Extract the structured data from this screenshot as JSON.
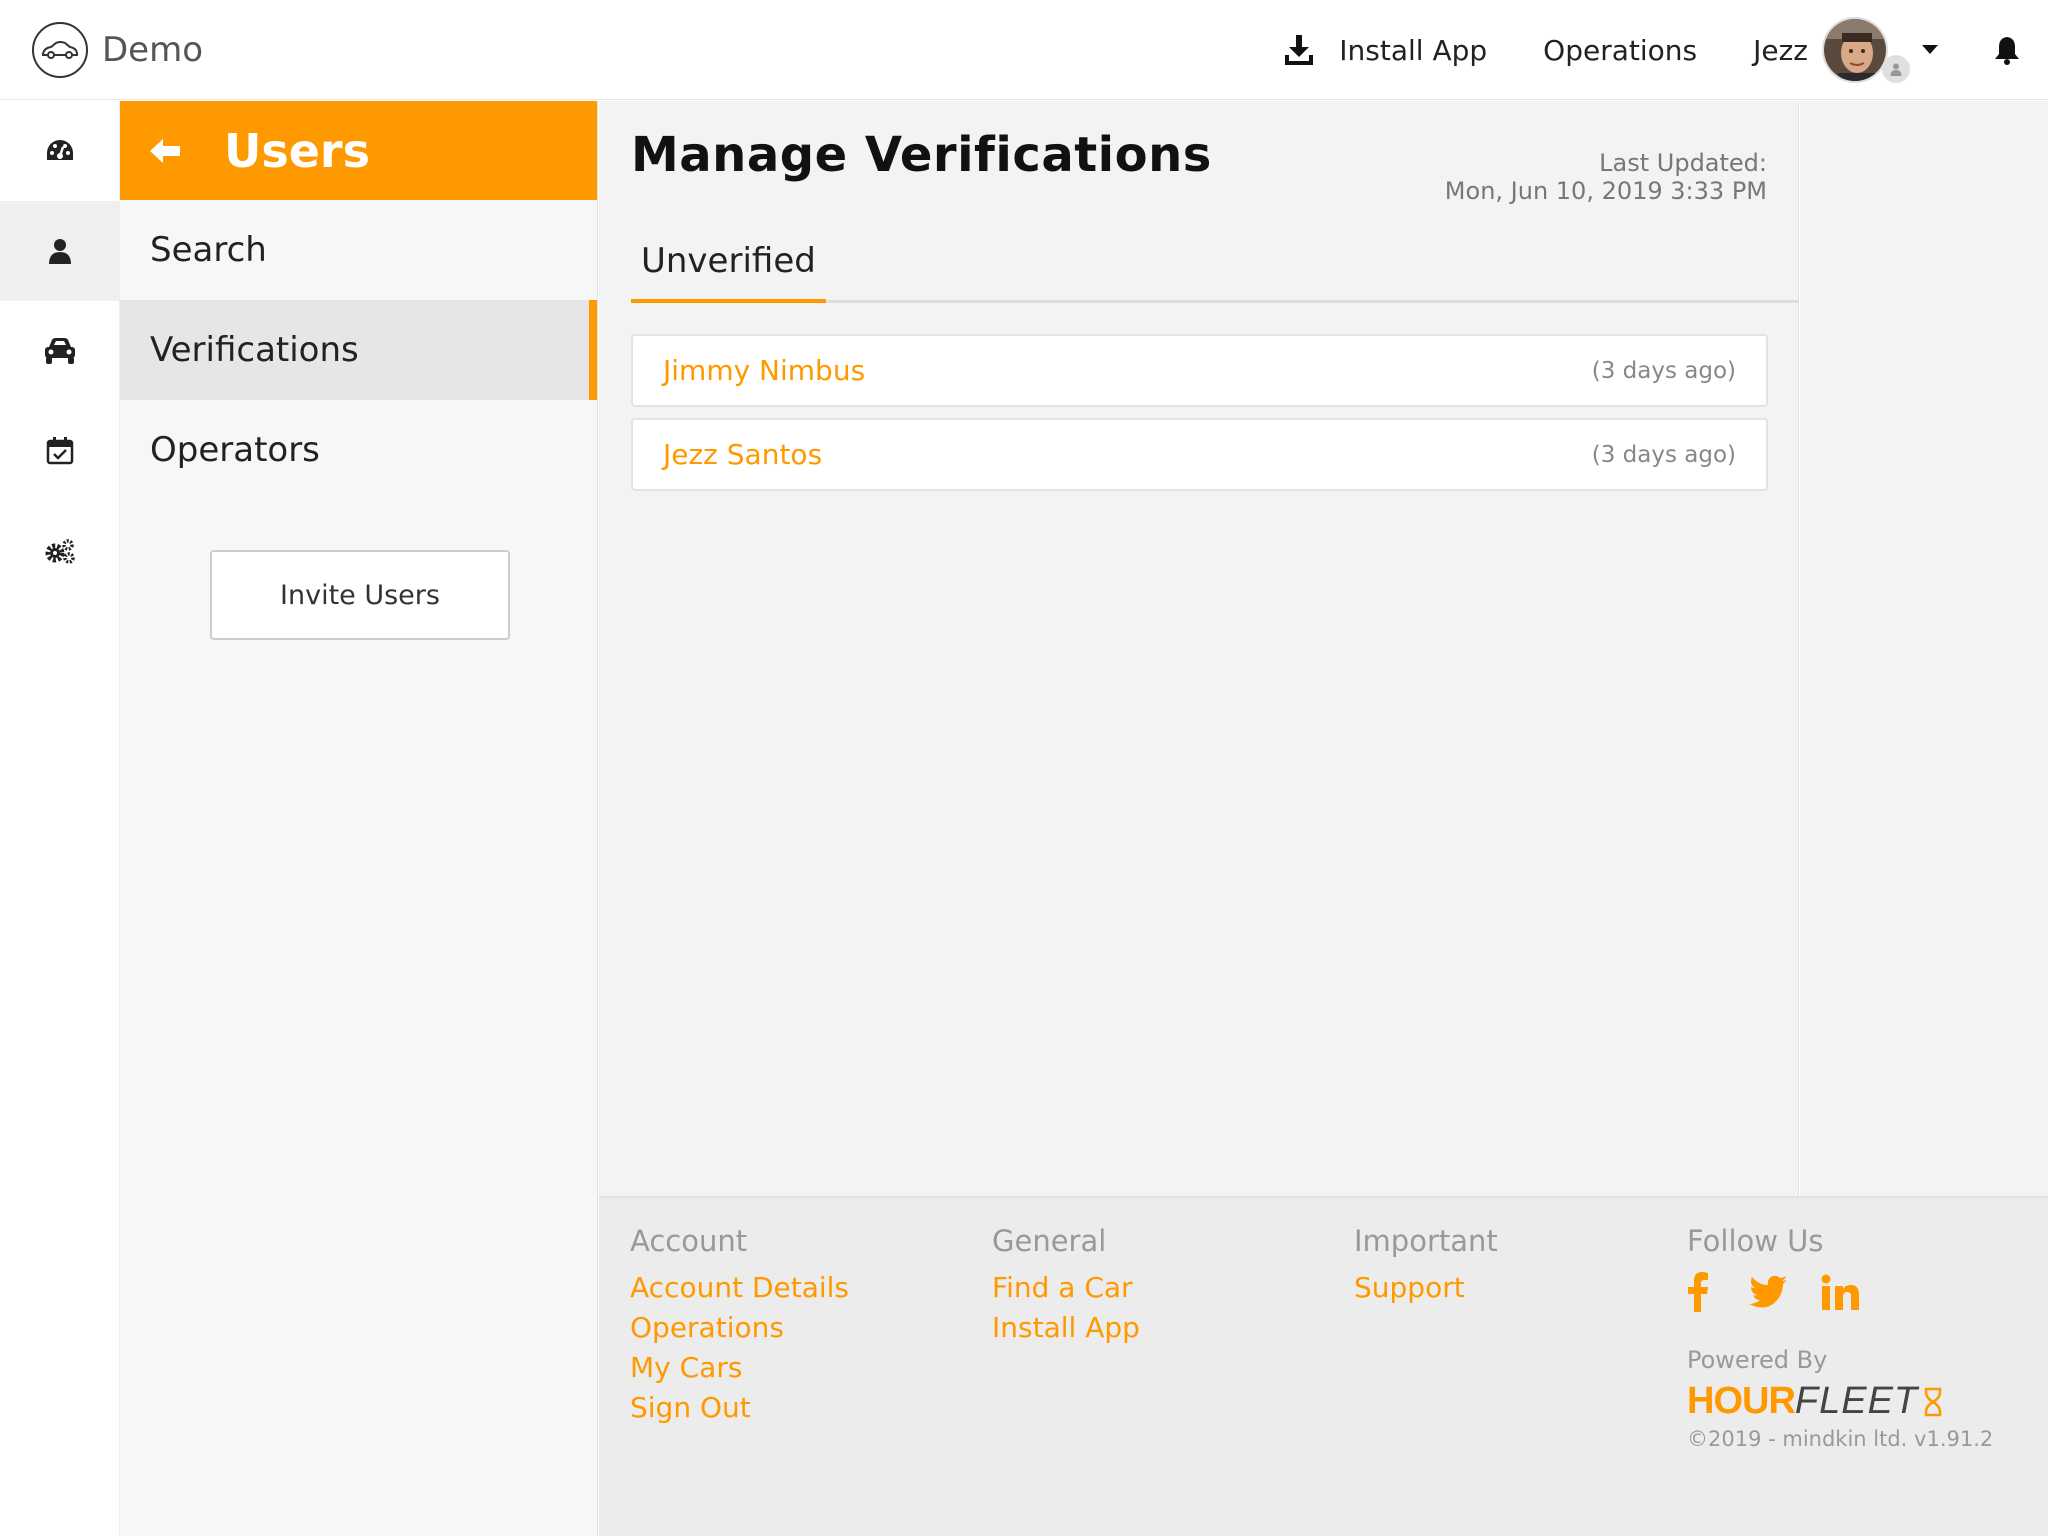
{
  "brand": {
    "name": "Demo",
    "logo_icon": "car-logo-icon"
  },
  "top_nav": {
    "install_label": "Install App",
    "operations_label": "Operations",
    "user_name": "Jezz"
  },
  "rail": {
    "items": [
      {
        "icon": "dashboard-icon",
        "active": false
      },
      {
        "icon": "user-icon",
        "active": true
      },
      {
        "icon": "car-icon",
        "active": false
      },
      {
        "icon": "calendar-check-icon",
        "active": false
      },
      {
        "icon": "gears-icon",
        "active": false
      }
    ]
  },
  "subnav": {
    "title": "Users",
    "items": [
      {
        "label": "Search",
        "active": false
      },
      {
        "label": "Verifications",
        "active": true
      },
      {
        "label": "Operators",
        "active": false
      }
    ],
    "invite_label": "Invite Users"
  },
  "main": {
    "title": "Manage Verifications",
    "last_updated_label": "Last Updated:",
    "last_updated_value": "Mon, Jun 10, 2019 3:33 PM",
    "tabs": [
      {
        "label": "Unverified",
        "active": true
      }
    ],
    "items": [
      {
        "name": "Jimmy Nimbus",
        "time": "(3 days ago)"
      },
      {
        "name": "Jezz Santos",
        "time": "(3 days ago)"
      }
    ]
  },
  "footer": {
    "account": {
      "heading": "Account",
      "links": [
        "Account Details",
        "Operations",
        "My Cars",
        "Sign Out"
      ]
    },
    "general": {
      "heading": "General",
      "links": [
        "Find a Car",
        "Install App"
      ]
    },
    "important": {
      "heading": "Important",
      "links": [
        "Support"
      ]
    },
    "follow": {
      "heading": "Follow Us"
    },
    "powered_by": "Powered By",
    "logo_hour": "HOUR",
    "logo_fleet": "FLEET",
    "copyright": "©2019 - mindkin ltd. v1.91.2"
  },
  "colors": {
    "accent": "#ff9900",
    "background": "#f3f3f3"
  }
}
